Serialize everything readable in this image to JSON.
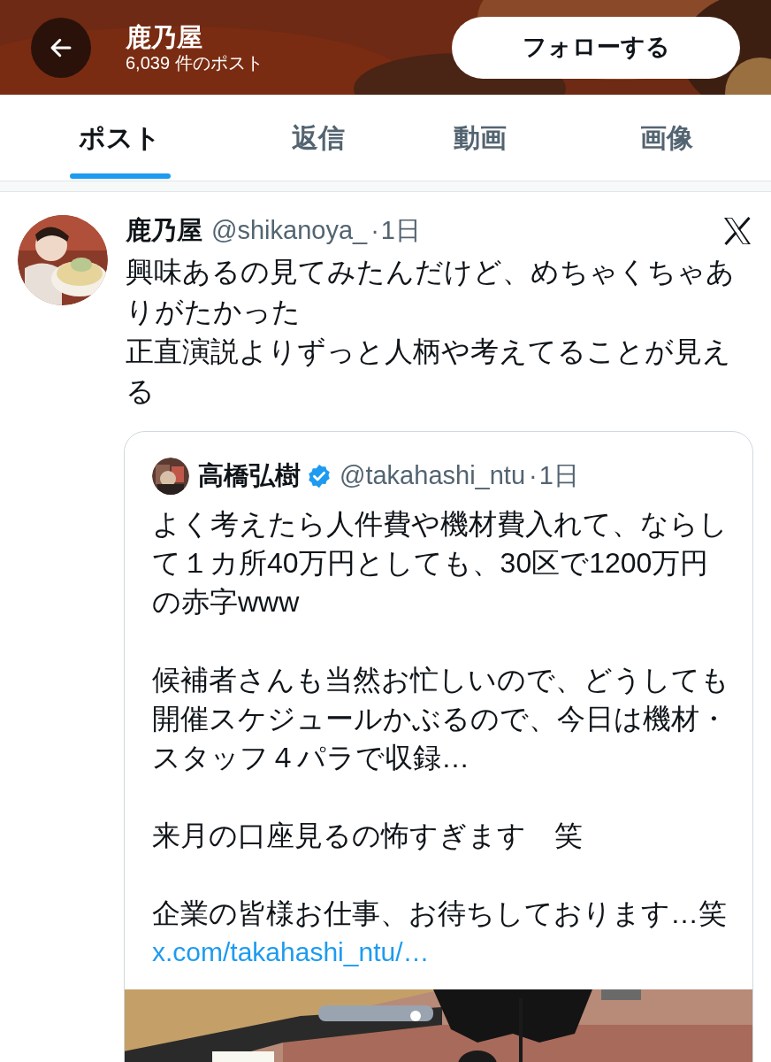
{
  "header": {
    "title": "鹿乃屋",
    "post_count": "6,039 件のポスト",
    "follow_button": "フォローする"
  },
  "tabs": [
    {
      "label": "ポスト",
      "selected": true
    },
    {
      "label": "返信",
      "selected": false
    },
    {
      "label": "動画",
      "selected": false
    },
    {
      "label": "画像",
      "selected": false
    }
  ],
  "post": {
    "author_name": "鹿乃屋",
    "handle": "@shikanoya_",
    "separator": "·",
    "time": "1日",
    "paragraphs": [
      "興味あるの見てみたんだけど、めちゃくちゃありがたかった",
      "正直演説よりずっと人柄や考えてることが見える"
    ],
    "quote": {
      "author_name": "高橋弘樹",
      "verified": true,
      "handle": "@takahashi_ntu",
      "separator": "·",
      "time": "1日",
      "paragraphs": [
        "よく考えたら人件費や機材費入れて、ならして１カ所40万円としても、30区で1200万円の赤字www",
        "候補者さんも当然お忙しいので、どうしても開催スケジュールかぶるので、今日は機材・スタッフ４パラで収録…",
        "来月の口座見るの怖すぎます　笑",
        "企業の皆様お仕事、お待ちしております…笑"
      ],
      "link": "x.com/takahashi_ntu/…"
    }
  }
}
